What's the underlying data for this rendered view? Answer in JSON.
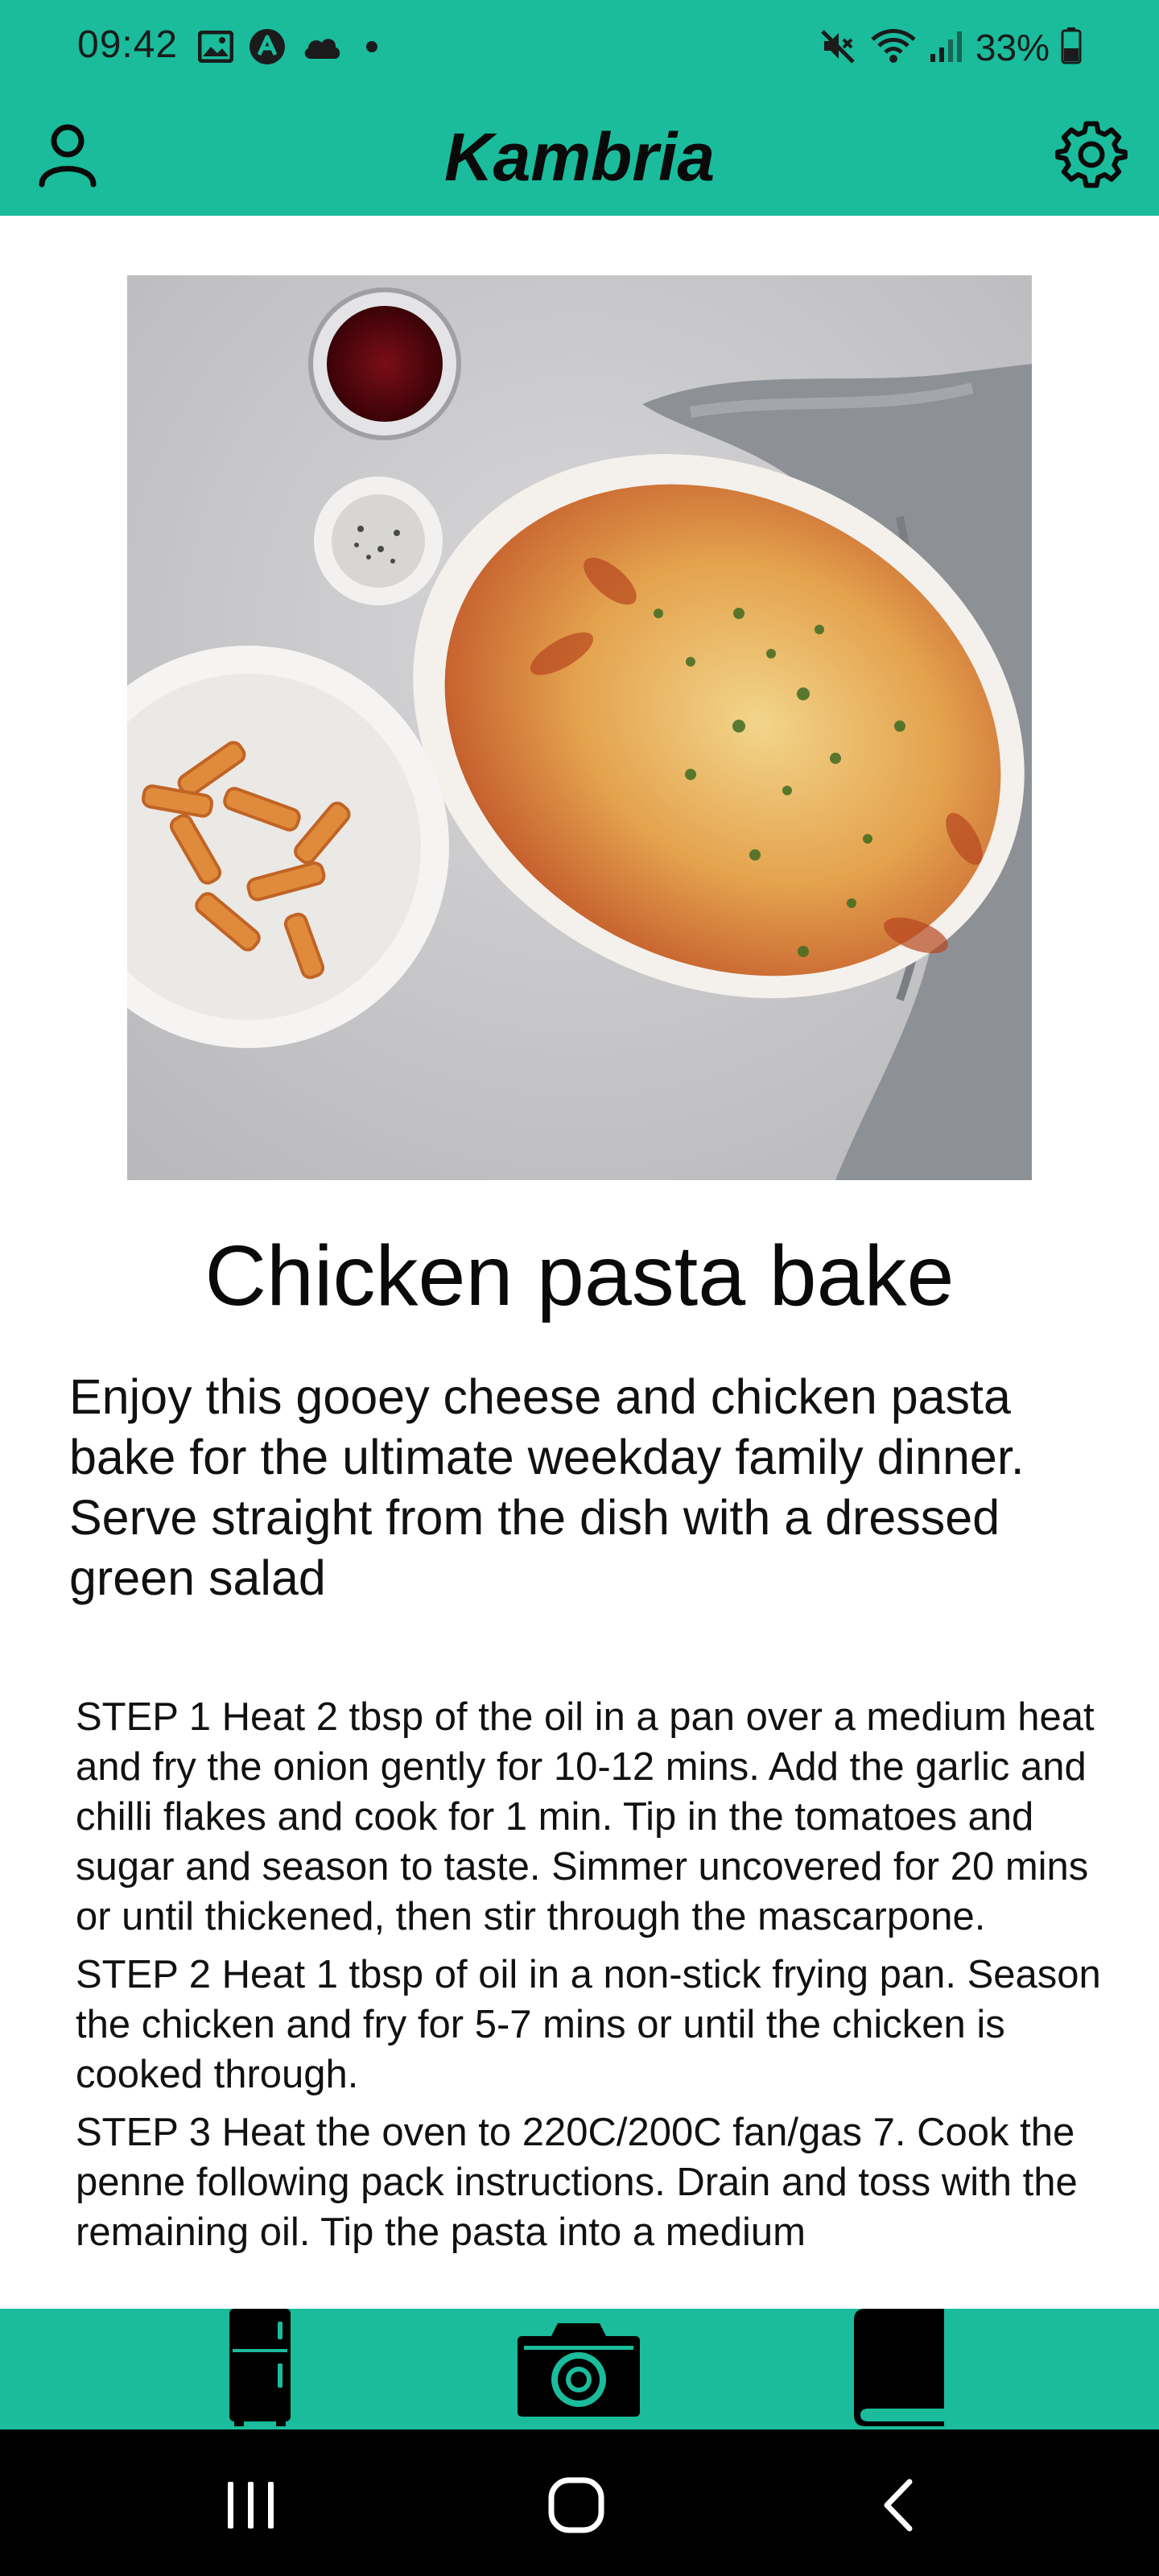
{
  "status_bar": {
    "time": "09:42",
    "battery": "33%",
    "left_icons": [
      "gallery-icon",
      "app-a-icon",
      "cloud-icon",
      "dot-icon"
    ],
    "right_icons": [
      "mute-icon",
      "wifi-icon",
      "signal-icon",
      "battery-icon"
    ]
  },
  "header": {
    "title": "Kambria",
    "left_icon": "profile-icon",
    "right_icon": "settings-gear-icon"
  },
  "recipe": {
    "image_alt": "Chicken pasta bake dish with plated penne, glass of red wine and pepper",
    "title": "Chicken pasta bake",
    "description": "Enjoy this gooey cheese and chicken pasta bake for the ultimate weekday family dinner. Serve straight from the dish with a dressed green salad",
    "steps": [
      "STEP 1 Heat 2 tbsp of the oil in a pan over a medium heat and fry the onion gently for 10-12 mins. Add the garlic and chilli flakes and cook for 1 min. Tip in the tomatoes and sugar and season to taste. Simmer uncovered for 20 mins or until thickened, then stir through the mascarpone.",
      "STEP 2 Heat 1 tbsp of oil in a non-stick frying pan. Season the chicken and fry for 5-7 mins or until the chicken is cooked through.",
      "STEP 3 Heat the oven to 220C/200C fan/gas 7. Cook the penne following pack instructions. Drain and toss with the remaining oil. Tip the pasta into a medium"
    ]
  },
  "bottom_nav": {
    "items": [
      "fridge-icon",
      "camera-icon",
      "book-icon"
    ]
  },
  "system_nav": {
    "items": [
      "recents-icon",
      "home-icon",
      "back-icon"
    ]
  },
  "colors": {
    "accent": "#1abc9c",
    "text": "#111111",
    "system_bar": "#000000"
  }
}
